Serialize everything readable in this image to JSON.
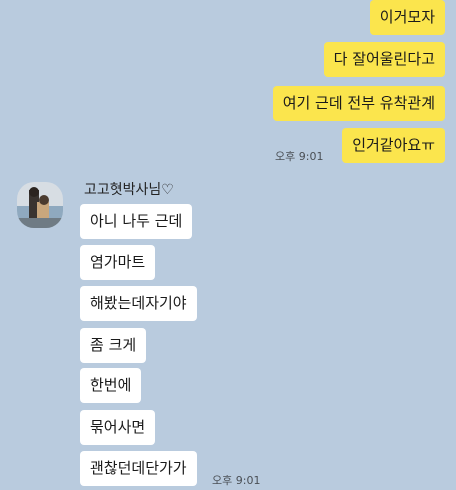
{
  "outgoing": {
    "messages": [
      "이거모자",
      "다 잘어울린다고",
      "여기 근데 전부 유착관계",
      "인거같아요ㅠ"
    ],
    "time": "오후 9:01"
  },
  "incoming": {
    "sender": "고고혓박사님♡",
    "messages": [
      "아니 나두 근데",
      "염가마트",
      "해봤는데자기야",
      "좀 크게",
      "한번에",
      "묶어사면",
      "괜찮던데단가가"
    ],
    "time": "오후 9:01"
  },
  "colors": {
    "background": "#b9cbde",
    "outgoing_bubble": "#fbe54d",
    "incoming_bubble": "#ffffff"
  }
}
